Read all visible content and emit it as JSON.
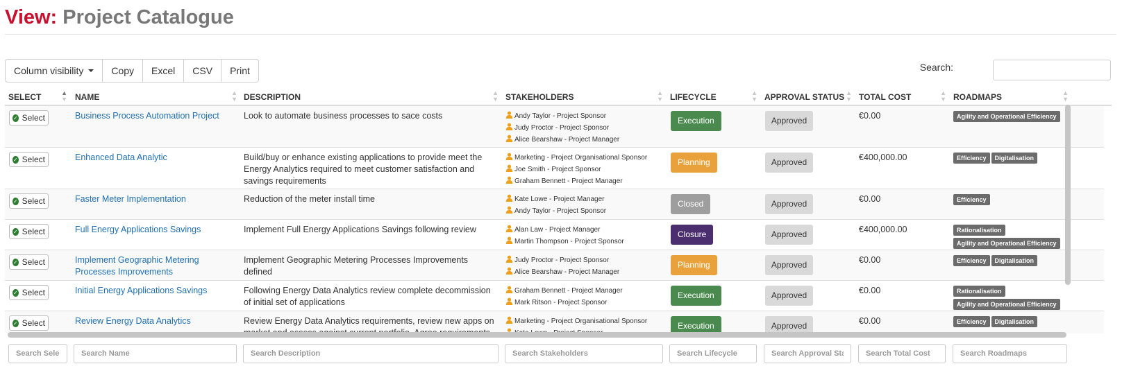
{
  "page": {
    "title_prefix": "View:",
    "title_main": "Project Catalogue"
  },
  "toolbar": {
    "buttons": [
      "Column visibility",
      "Copy",
      "Excel",
      "CSV",
      "Print"
    ],
    "search_label": "Search:"
  },
  "table": {
    "columns": [
      "Select",
      "Name",
      "Description",
      "Stakeholders",
      "Lifecycle",
      "Approval Status",
      "Total Cost",
      "Roadmaps"
    ],
    "select_label": "Select",
    "rows": [
      {
        "name": "Business Process Automation Project",
        "description": "Look to automate business processes to sace costs",
        "stakeholders": [
          "Andy Taylor - Project Sponsor",
          "Judy Proctor - Project Sponsor",
          "Alice Bearshaw - Project Manager"
        ],
        "lifecycle": "Execution",
        "approval": "Approved",
        "total_cost": "€0.00",
        "roadmaps": [
          "Agility and Operational Efficiency"
        ]
      },
      {
        "name": "Enhanced Data Analytic",
        "description": "Build/buy or enhance existing applications to provide meet the Energy Analytics required to meet customer satisfaction and savings requirements",
        "stakeholders": [
          "Marketing - Project Organisational Sponsor",
          "Joe Smith - Project Sponsor",
          "Graham Bennett - Project Manager"
        ],
        "lifecycle": "Planning",
        "approval": "Approved",
        "total_cost": "€400,000.00",
        "roadmaps": [
          "Efficiency",
          "Digitalisation"
        ]
      },
      {
        "name": "Faster Meter Implementation",
        "description": "Reduction of the meter install time",
        "stakeholders": [
          "Kate Lowe - Project Manager",
          "Andy Taylor - Project Sponsor"
        ],
        "lifecycle": "Closed",
        "approval": "Approved",
        "total_cost": "€0.00",
        "roadmaps": [
          "Efficiency"
        ]
      },
      {
        "name": "Full Energy Applications Savings",
        "description": "Implement Full Energy Applications Savings following review",
        "stakeholders": [
          "Alan Law - Project Manager",
          "Martin Thompson - Project Sponsor"
        ],
        "lifecycle": "Closure",
        "approval": "Approved",
        "total_cost": "€400,000.00",
        "roadmaps": [
          "Rationalisation",
          "Agility and Operational Efficiency"
        ]
      },
      {
        "name": "Implement Geographic Metering Processes Improvements",
        "description": "Implement Geographic Metering Processes Improvements defined",
        "stakeholders": [
          "Judy Proctor - Project Sponsor",
          "Alice Bearshaw - Project Manager"
        ],
        "lifecycle": "Planning",
        "approval": "Approved",
        "total_cost": "€0.00",
        "roadmaps": [
          "Efficiency",
          "Digitalisation"
        ]
      },
      {
        "name": "Initial Energy Applications Savings",
        "description": "Following Energy Data Analytics review complete decommission of initial set of applications",
        "stakeholders": [
          "Graham Bennett - Project Manager",
          "Mark Ritson - Project Sponsor"
        ],
        "lifecycle": "Execution",
        "approval": "Approved",
        "total_cost": "€0.00",
        "roadmaps": [
          "Rationalisation",
          "Agility and Operational Efficiency"
        ]
      },
      {
        "name": "Review Energy Data Analytics",
        "description": "Review Energy Data Analytics requirements, review new apps on market and assess against current portfolio. Agree requirements with business",
        "stakeholders": [
          "Marketing - Project Organisational Sponsor",
          "Kate Lowe - Project Sponsor"
        ],
        "lifecycle": "Execution",
        "approval": "Approved",
        "total_cost": "€0.00",
        "roadmaps": [
          "Efficiency",
          "Digitalisation"
        ]
      }
    ]
  },
  "filters": [
    "Search Selec",
    "Search Name",
    "Search Description",
    "Search Stakeholders",
    "Search Lifecycle",
    "Search Approval Stat",
    "Search Total Cost",
    "Search Roadmaps"
  ],
  "colors": {
    "title_prefix": "#c8102e",
    "link": "#1f6fb2",
    "execution": "#4a8a4f",
    "planning": "#e9a23b",
    "closed": "#9e9e9e",
    "closure": "#4b2e6e",
    "approved_bg": "#d9d9d9",
    "roadmap_tag": "#6b6b6b"
  },
  "icons": {
    "sort": "sort-arrows-icon",
    "select": "check-circle-icon",
    "stakeholder": "person-icon",
    "dropdown": "caret-down-icon"
  }
}
